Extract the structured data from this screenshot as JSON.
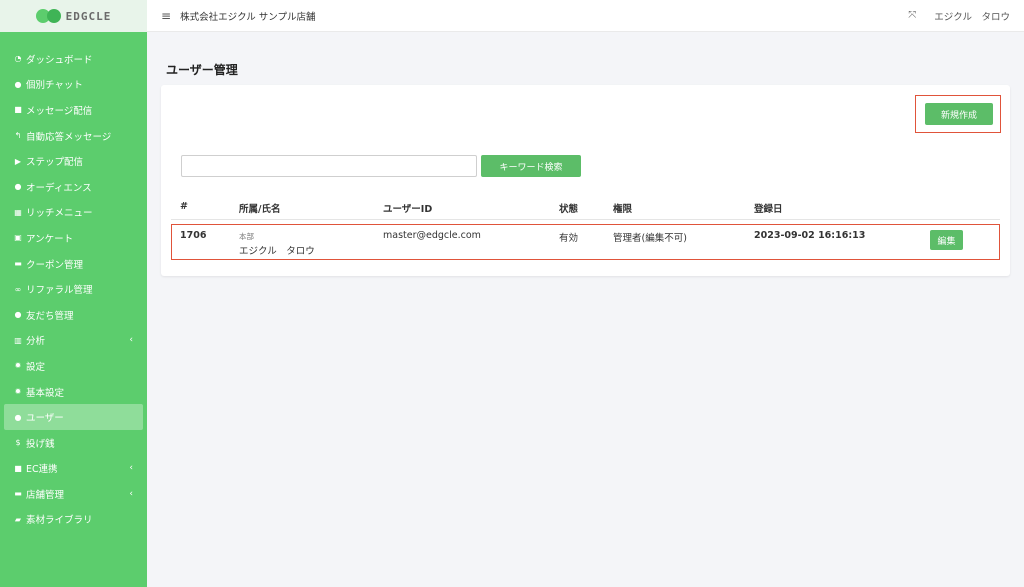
{
  "brand": {
    "name": "EDGCLE"
  },
  "topbar": {
    "shop_name": "株式会社エジクル サンプル店舗",
    "user_name": "エジクル　タロウ"
  },
  "sidebar": {
    "items": [
      {
        "label": "ダッシュボード",
        "icon": "dashboard-icon",
        "glyph": "◔"
      },
      {
        "label": "個別チャット",
        "icon": "chat-icon",
        "glyph": "●"
      },
      {
        "label": "メッセージ配信",
        "icon": "message-icon",
        "glyph": "■"
      },
      {
        "label": "自動応答メッセージ",
        "icon": "reply-icon",
        "glyph": "↰"
      },
      {
        "label": "ステップ配信",
        "icon": "play-circle-icon",
        "glyph": "▶"
      },
      {
        "label": "オーディエンス",
        "icon": "users-icon",
        "glyph": "●"
      },
      {
        "label": "リッチメニュー",
        "icon": "grid-icon",
        "glyph": "▦"
      },
      {
        "label": "アンケート",
        "icon": "survey-icon",
        "glyph": "▣"
      },
      {
        "label": "クーポン管理",
        "icon": "ticket-icon",
        "glyph": "▬"
      },
      {
        "label": "リファラル管理",
        "icon": "link-icon",
        "glyph": "∞"
      },
      {
        "label": "友だち管理",
        "icon": "friends-icon",
        "glyph": "●"
      },
      {
        "label": "分析",
        "icon": "chart-icon",
        "glyph": "▥"
      },
      {
        "label": "設定",
        "icon": "gear-icon",
        "glyph": "✹"
      },
      {
        "label": "基本設定",
        "icon": "gear-icon",
        "glyph": "✹"
      },
      {
        "label": "ユーザー",
        "icon": "user-icon",
        "glyph": "●"
      },
      {
        "label": "投げ銭",
        "icon": "dollar-icon",
        "glyph": "$"
      },
      {
        "label": "EC連携",
        "icon": "bag-icon",
        "glyph": "■"
      },
      {
        "label": "店舗管理",
        "icon": "store-icon",
        "glyph": "▬"
      },
      {
        "label": "素材ライブラリ",
        "icon": "folder-icon",
        "glyph": "▰"
      }
    ]
  },
  "main": {
    "page_title": "ユーザー管理",
    "new_button": "新規作成",
    "search": {
      "placeholder": "",
      "button": "キーワード検索"
    },
    "table": {
      "headers": [
        "#",
        "所属/氏名",
        "ユーザーID",
        "状態",
        "権限",
        "登録日"
      ],
      "rows": [
        {
          "id": "1706",
          "dept": "本部",
          "name": "エジクル　タロウ",
          "user_id": "master@edgcle.com",
          "status": "有効",
          "role": "管理者(編集不可)",
          "created": "2023-09-02 16:16:13",
          "edit": "編集"
        }
      ]
    }
  },
  "colors": {
    "sidebar": "#5ccd6d",
    "accent": "#5cbd68",
    "highlight": "#e0533a"
  }
}
